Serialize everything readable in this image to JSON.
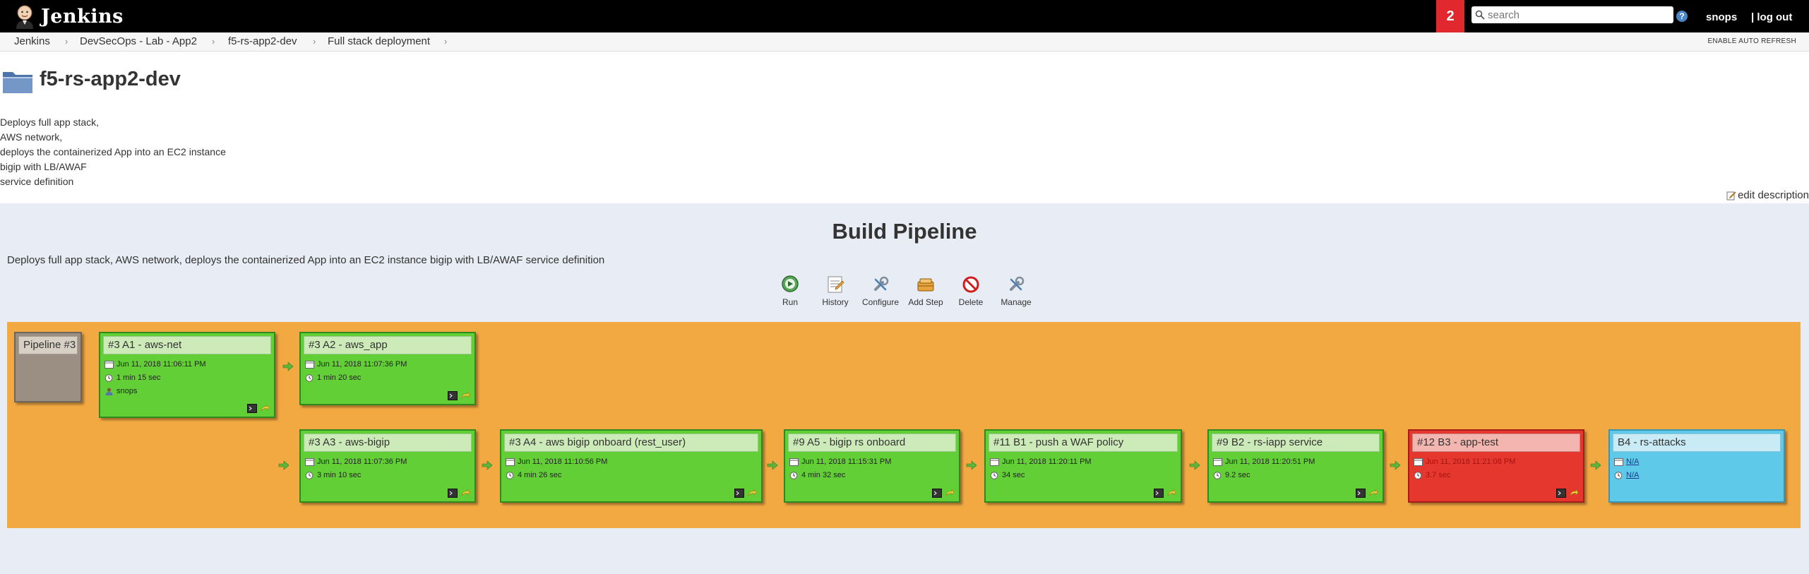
{
  "header": {
    "brand": "Jenkins",
    "notification_count": "2",
    "search_placeholder": "search",
    "help": "?",
    "user": "snops",
    "logout": "| log out"
  },
  "breadcrumb": {
    "items": [
      "Jenkins",
      "DevSecOps - Lab - App2",
      "f5-rs-app2-dev",
      "Full stack deployment"
    ],
    "auto_refresh": "ENABLE AUTO REFRESH"
  },
  "main": {
    "title": "f5-rs-app2-dev",
    "description_lines": [
      "Deploys full app stack,",
      "AWS network,",
      "deploys the containerized App into an EC2 instance",
      "bigip with LB/AWAF",
      "service definition"
    ],
    "edit_description": "edit description"
  },
  "pipeline": {
    "title": "Build Pipeline",
    "description": "Deploys full app stack, AWS network, deploys the containerized App into an EC2 instance bigip with LB/AWAF service definition",
    "toolbar": {
      "run": "Run",
      "history": "History",
      "configure": "Configure",
      "add_step": "Add Step",
      "delete": "Delete",
      "manage": "Manage"
    },
    "pipeline_label": "Pipeline #3",
    "builds": {
      "a1": {
        "title": "#3 A1 - aws-net",
        "date": "Jun 11, 2018 11:06:11 PM",
        "duration": "1 min 15 sec",
        "user": "snops",
        "status": "success"
      },
      "a2": {
        "title": "#3 A2 - aws_app",
        "date": "Jun 11, 2018 11:07:36 PM",
        "duration": "1 min 20 sec",
        "status": "success"
      },
      "a3": {
        "title": "#3 A3 - aws-bigip",
        "date": "Jun 11, 2018 11:07:36 PM",
        "duration": "3 min 10 sec",
        "status": "success"
      },
      "a4": {
        "title": "#3 A4 - aws bigip onboard (rest_user)",
        "date": "Jun 11, 2018 11:10:56 PM",
        "duration": "4 min 26 sec",
        "status": "success"
      },
      "a5": {
        "title": "#9 A5 - bigip rs onboard",
        "date": "Jun 11, 2018 11:15:31 PM",
        "duration": "4 min 32 sec",
        "status": "success"
      },
      "b1": {
        "title": "#11 B1 - push a WAF policy",
        "date": "Jun 11, 2018 11:20:11 PM",
        "duration": "34 sec",
        "status": "success"
      },
      "b2": {
        "title": "#9 B2 - rs-iapp service",
        "date": "Jun 11, 2018 11:20:51 PM",
        "duration": "9.2 sec",
        "status": "success"
      },
      "b3": {
        "title": "#12 B3 - app-test",
        "date": "Jun 11, 2018 11:21:08 PM",
        "duration": "3.7 sec",
        "status": "failed"
      },
      "b4": {
        "title": "B4 - rs-attacks",
        "date": "N/A",
        "duration": "N/A",
        "status": "pending"
      }
    }
  },
  "colors": {
    "success": "#63cf37",
    "failed": "#e6372e",
    "pending": "#5ec9e8",
    "board": "#f3a942",
    "header": "#000000",
    "badge": "#e0282e"
  }
}
